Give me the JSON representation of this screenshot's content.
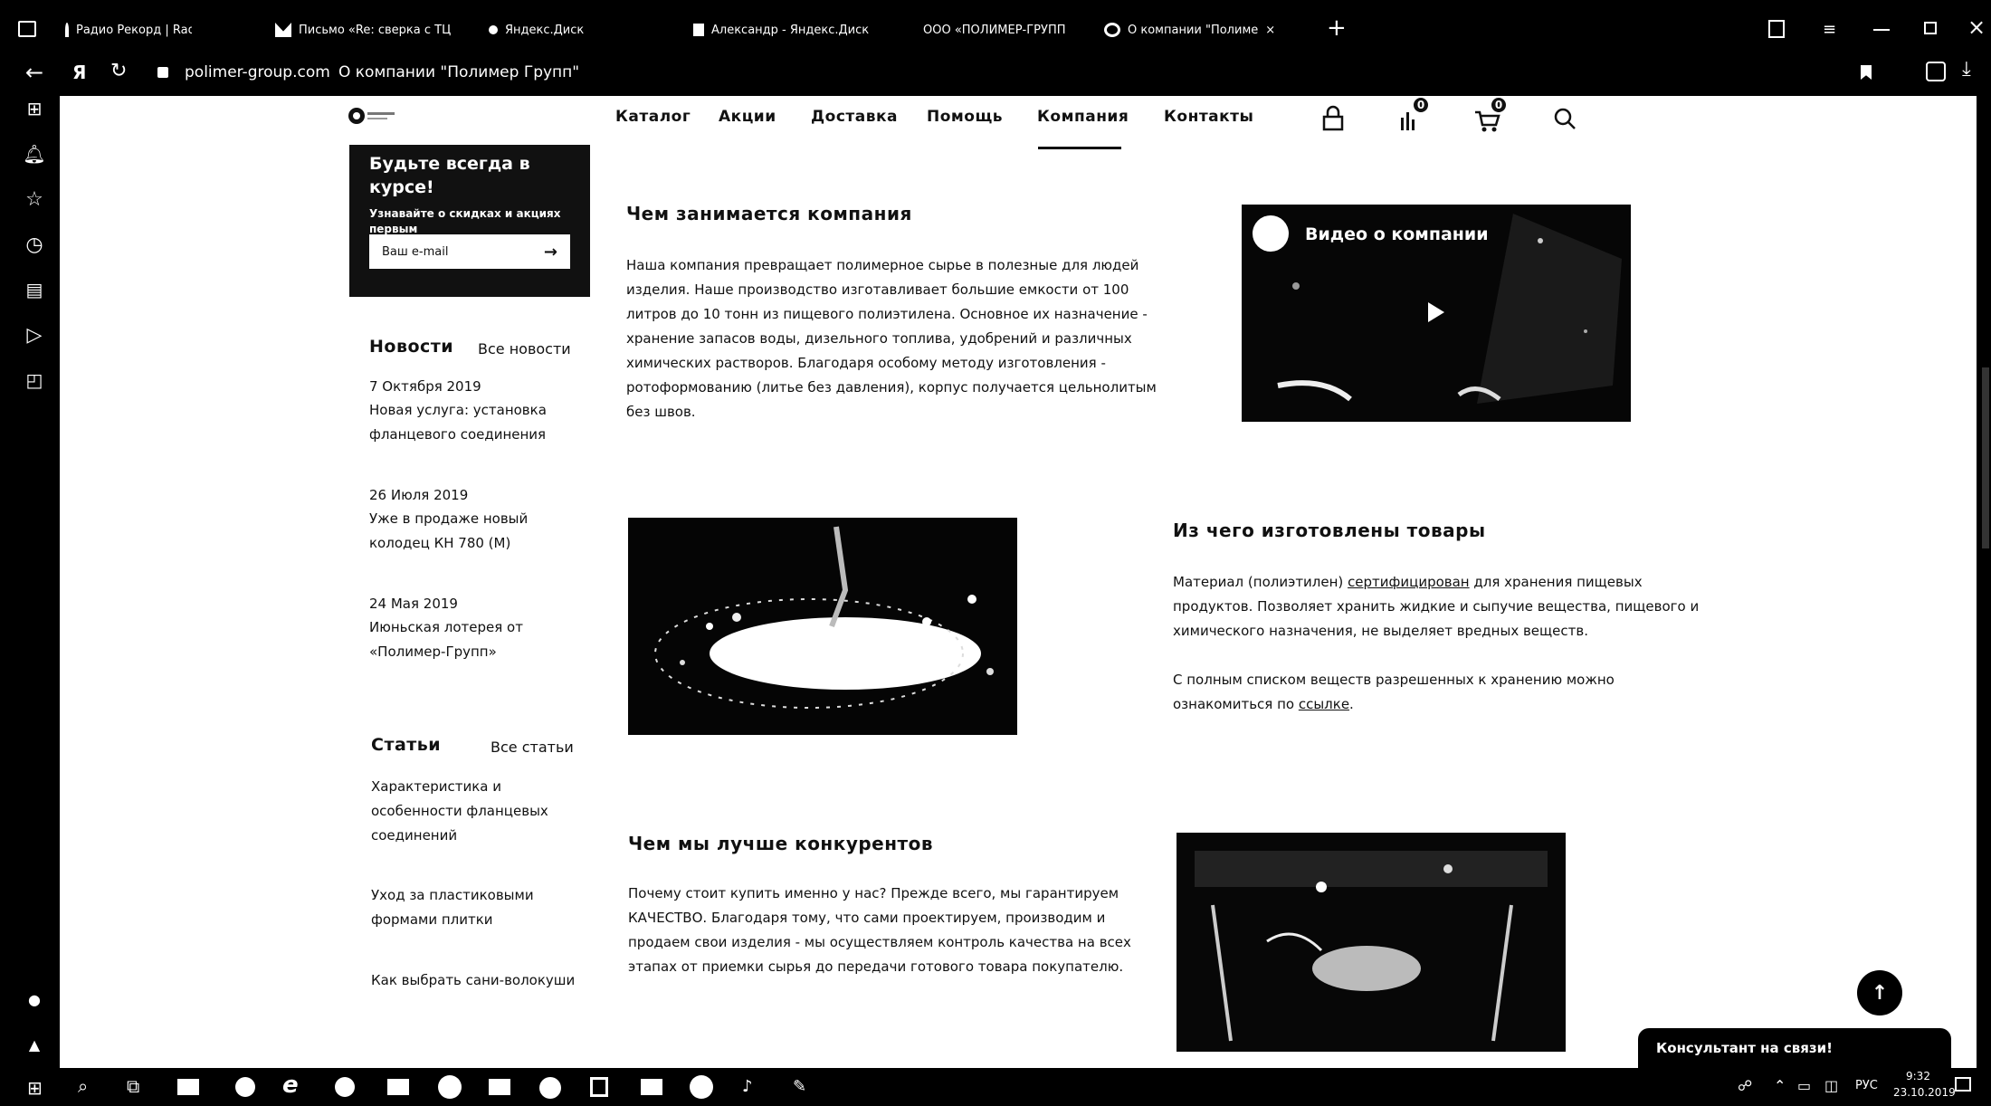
{
  "browser": {
    "tabs": [
      {
        "label": "Радио Рекорд | Radio Re",
        "icon": "radio-icon"
      },
      {
        "label": "Письмо «Re: сверка с ТЦ",
        "icon": "mail-icon"
      },
      {
        "label": "Яндекс.Диск",
        "icon": "disk-icon"
      },
      {
        "label": "Александр - Яндекс.Диск",
        "icon": "disk-icon"
      },
      {
        "label": "ООО «ПОЛИМЕР-ГРУПП",
        "icon": "site-icon"
      },
      {
        "label": "О компании \"Полиме",
        "icon": "site-icon"
      }
    ],
    "new_tab": "+",
    "address_domain": "polimer-group.com",
    "address_title": "О компании \"Полимер Групп\"",
    "yandex_glyph": "Я"
  },
  "nav": {
    "items": [
      "Каталог",
      "Акции",
      "Доставка",
      "Помощь",
      "Компания",
      "Контакты"
    ],
    "active": "Компания",
    "compare_count": "0",
    "cart_count": "0"
  },
  "subscribe": {
    "title": "Будьте всегда в курсе!",
    "text": "Узнавайте о скидках и акциях первым",
    "placeholder": "Ваш e-mail"
  },
  "news": {
    "heading": "Новости",
    "all_link": "Все новости",
    "items": [
      {
        "date": "7 Октября 2019",
        "text": "Новая услуга: установка фланцевого соединения"
      },
      {
        "date": "26 Июля 2019",
        "text": "Уже в продаже новый колодец КН 780 (М)"
      },
      {
        "date": "24 Мая 2019",
        "text": "Июньская лотерея от «Полимер-Групп»"
      }
    ]
  },
  "articles": {
    "heading": "Статьи",
    "all_link": "Все статьи",
    "items": [
      "Характеристика и особенности фланцевых соединений",
      "Уход за пластиковыми формами плитки",
      "Как выбрать сани-волокуши"
    ]
  },
  "section1": {
    "title": "Чем занимается компания",
    "text": "Наша компания превращает полимерное сырье в полезные для людей изделия. Наше производство изготавливает большие емкости от 100 литров до 10 тонн из пищевого полиэтилена. Основное их назначение - хранение запасов воды, дизельного топлива, удобрений и различных химических растворов. Благодаря особому методу изготовления - ротоформованию (литье без давления), корпус получается цельнолитым без швов."
  },
  "video": {
    "label": "Видео о компании"
  },
  "section2": {
    "title": "Из чего изготовлены товары",
    "p1_before": "Материал (полиэтилен) ",
    "p1_link": "сертифицирован",
    "p1_after": " для хранения пищевых продуктов. Позволяет хранить жидкие и сыпучие вещества, пищевого и химического назначения, не выделяет вредных веществ.",
    "p2_before": "С полным списком веществ разрешенных к хранению можно ознакомиться по ",
    "p2_link": "ссылке",
    "p2_after": "."
  },
  "section3": {
    "title": "Чем мы лучше конкурентов",
    "text": "Почему стоит купить именно у нас? Прежде всего, мы гарантируем КАЧЕСТВО. Благодаря тому, что сами проектируем, производим и продаем свои изделия - мы осуществляем контроль качества на всех этапах от приемки сырья до передачи готового товара покупателю."
  },
  "chat": {
    "label": "Консультант на связи!"
  },
  "taskbar": {
    "lang": "РУС",
    "time": "9:32",
    "date": "23.10.2019"
  }
}
